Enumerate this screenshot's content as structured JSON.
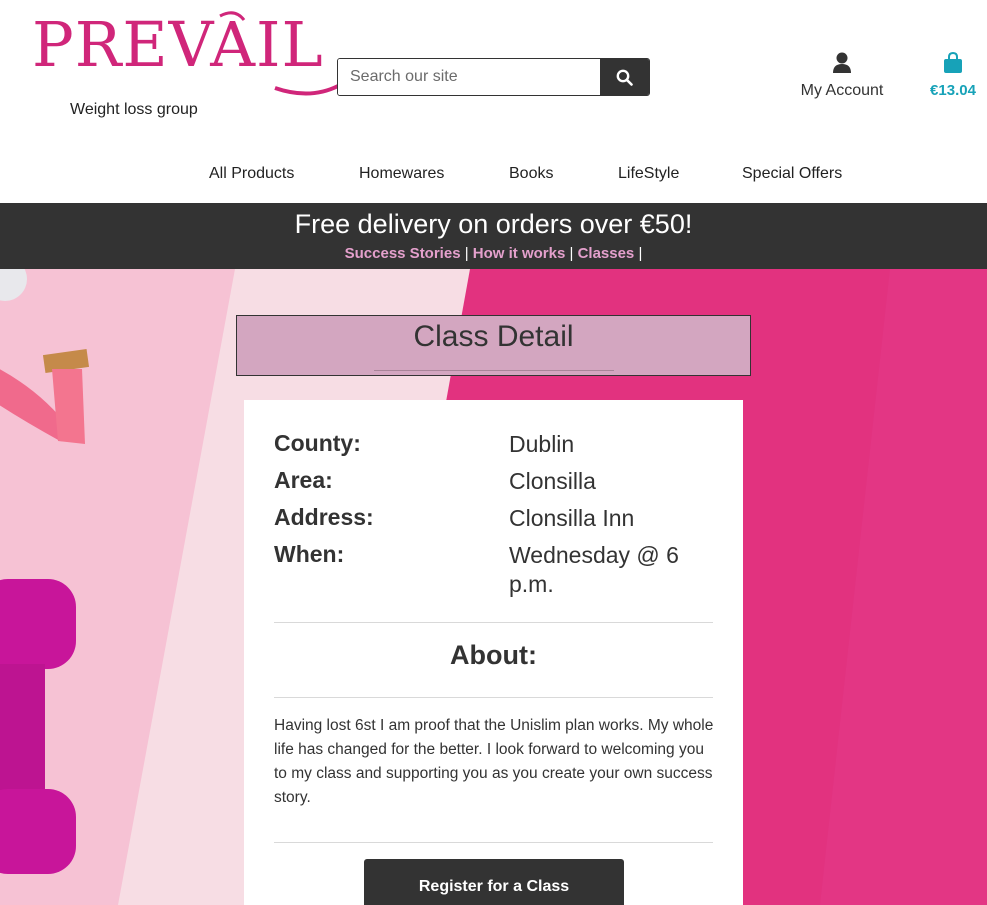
{
  "header": {
    "logo_text": "PREVAIL",
    "logo_tagline": "Weight loss group",
    "search_placeholder": "Search our site",
    "account_label": "My Account",
    "bag_total": "€13.04"
  },
  "nav": {
    "items": [
      {
        "label": "All Products"
      },
      {
        "label": "Homewares"
      },
      {
        "label": "Books"
      },
      {
        "label": "LifeStyle"
      },
      {
        "label": "Special Offers"
      }
    ]
  },
  "banner": {
    "title": "Free delivery on orders over €50!",
    "links": [
      {
        "label": "Success Stories"
      },
      {
        "label": "How it works"
      },
      {
        "label": "Classes"
      }
    ],
    "separator": "|"
  },
  "page": {
    "title": "Class Detail"
  },
  "details": [
    {
      "label": "County:",
      "value": "Dublin"
    },
    {
      "label": "Area:",
      "value": "Clonsilla"
    },
    {
      "label": "Address:",
      "value": "Clonsilla Inn"
    },
    {
      "label": "When:",
      "value": "Wednesday @ 6 p.m."
    }
  ],
  "about": {
    "title": "About:",
    "text": "Having lost 6st I am proof that the Unislim plan works. My whole life has changed for the better. I look forward to welcoming you to my class and supporting you as you create your own success story."
  },
  "register_label": "Register for a Class",
  "colors": {
    "brand_pink": "#d0267a",
    "bag_teal": "#17a2b8",
    "dark": "#333333",
    "heading_bg": "#d3a6c0",
    "link_pink": "#e4a0cc"
  }
}
